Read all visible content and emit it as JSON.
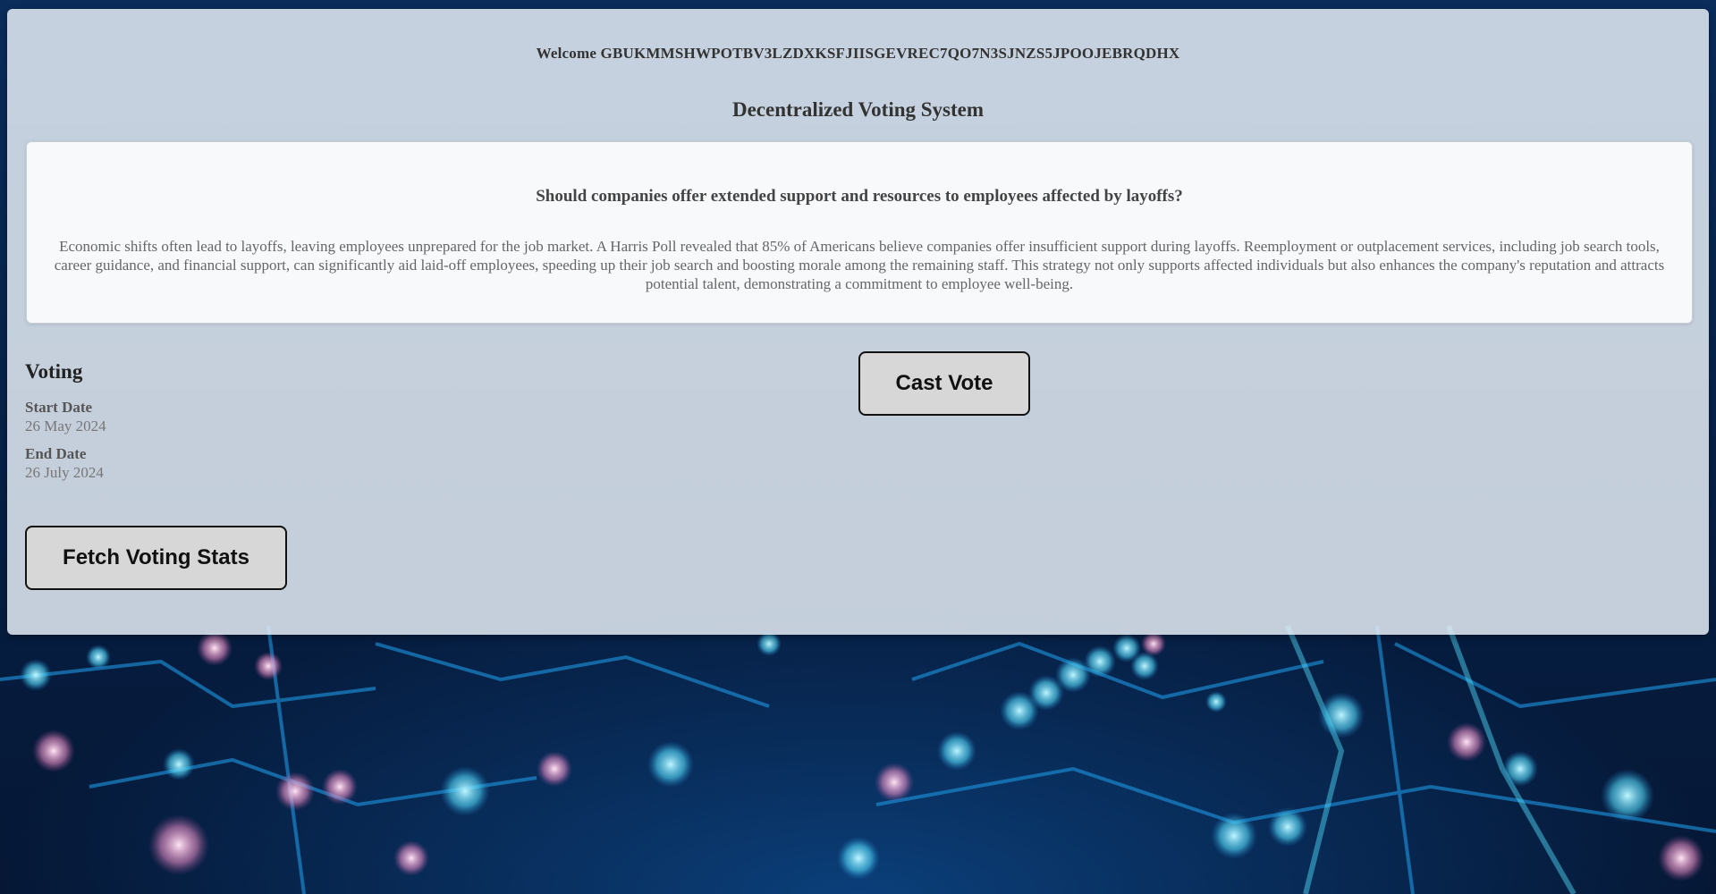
{
  "header": {
    "welcome_text": "Welcome GBUKMMSHWPOTBV3LZDXKSFJIISGEVREC7QO7N3SJNZS5JPOOJEBRQDHX",
    "title": "Decentralized Voting System"
  },
  "proposal": {
    "question": "Should companies offer extended support and resources to employees affected by layoffs?",
    "description": "Economic shifts often lead to layoffs, leaving employees unprepared for the job market. A Harris Poll revealed that 85% of Americans believe companies offer insufficient support during layoffs. Reemployment or outplacement services, including job search tools, career guidance, and financial support, can significantly aid laid-off employees, speeding up their job search and boosting morale among the remaining staff. This strategy not only supports affected individuals but also enhances the company's reputation and attracts potential talent, demonstrating a commitment to employee well-being."
  },
  "voting": {
    "heading": "Voting",
    "start_label": "Start Date",
    "start_date": "26 May 2024",
    "end_label": "End Date",
    "end_date": "26 July 2024"
  },
  "actions": {
    "cast_vote_label": "Cast Vote",
    "fetch_stats_label": "Fetch Voting Stats"
  },
  "colors": {
    "panel_background": "#e4ecf5",
    "button_background": "#d7d7d7",
    "button_border": "#111111"
  }
}
